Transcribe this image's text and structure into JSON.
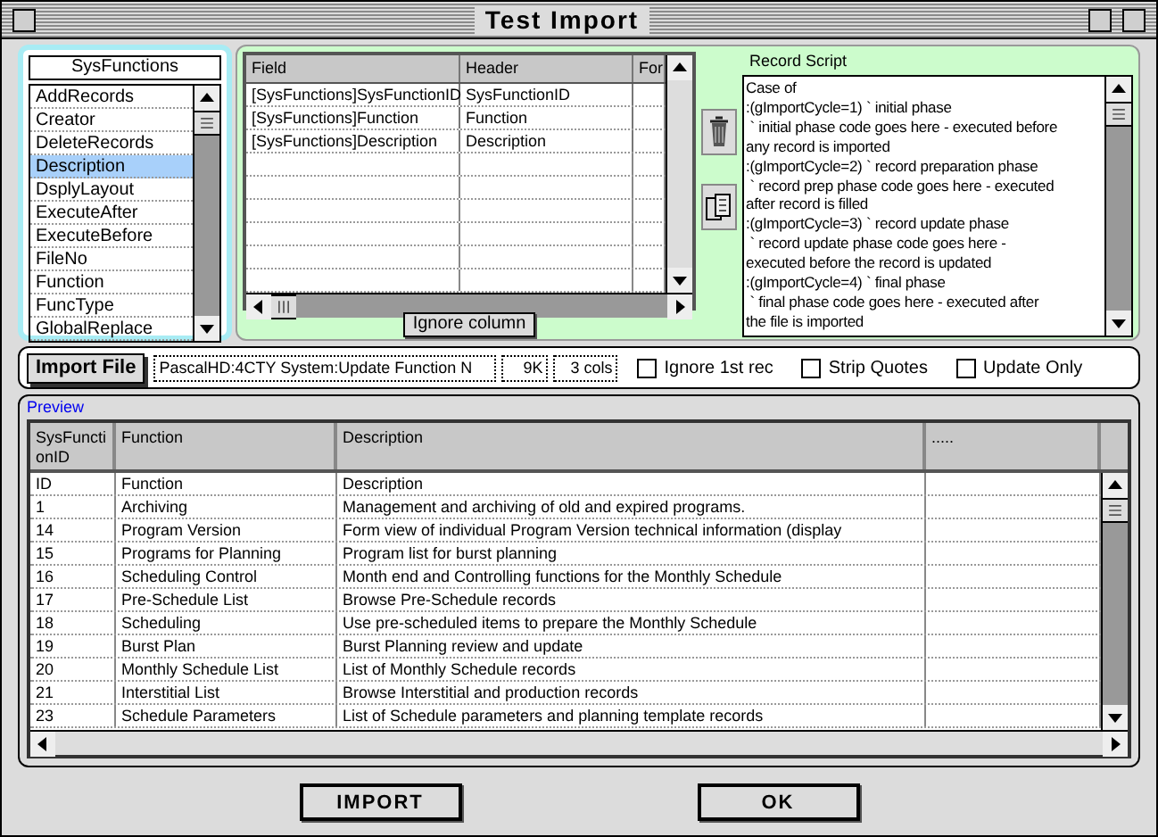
{
  "window": {
    "title": "Test Import"
  },
  "tables_list": {
    "title": "SysFunctions",
    "items": [
      {
        "label": "AddRecords",
        "selected": false
      },
      {
        "label": "Creator",
        "selected": false
      },
      {
        "label": "DeleteRecords",
        "selected": false
      },
      {
        "label": "Description",
        "selected": true
      },
      {
        "label": "DsplyLayout",
        "selected": false
      },
      {
        "label": "ExecuteAfter",
        "selected": false
      },
      {
        "label": "ExecuteBefore",
        "selected": false
      },
      {
        "label": "FileNo",
        "selected": false
      },
      {
        "label": "Function",
        "selected": false
      },
      {
        "label": "FuncType",
        "selected": false
      },
      {
        "label": "GlobalReplace",
        "selected": false
      }
    ]
  },
  "field_grid": {
    "columns": [
      "Field",
      "Header",
      "For"
    ],
    "rows": [
      {
        "field": "[SysFunctions]SysFunctionID",
        "header": "SysFunctionID"
      },
      {
        "field": "[SysFunctions]Function",
        "header": "Function"
      },
      {
        "field": "[SysFunctions]Description",
        "header": "Description"
      }
    ]
  },
  "ignore_column_button": "Ignore column",
  "record_script": {
    "label": "Record Script",
    "lines": [
      "Case of",
      ":(gImportCycle=1) ` initial phase",
      " ` initial phase code goes here - executed before",
      "any record is imported",
      ":(gImportCycle=2) ` record preparation phase",
      " ` record prep phase code goes here - executed",
      "after record is filled",
      ":(gImportCycle=3) ` record update phase",
      " ` record update phase code goes here -",
      "executed before the record is updated",
      ":(gImportCycle=4) ` final phase",
      " ` final phase code goes here - executed after",
      "the file is imported"
    ]
  },
  "import_file": {
    "button": "Import File",
    "path": "PascalHD:4CTY System:Update Function N",
    "size": "9K",
    "cols": "3 cols"
  },
  "options": [
    {
      "label": "Ignore 1st rec",
      "checked": false
    },
    {
      "label": "Strip Quotes",
      "checked": false
    },
    {
      "label": "Update Only",
      "checked": false
    }
  ],
  "preview": {
    "label": "Preview",
    "columns": [
      "SysFunctionID",
      "Function",
      "Description",
      "....."
    ],
    "rows": [
      [
        "ID",
        "Function",
        "Description"
      ],
      [
        "1",
        "Archiving",
        "Management and archiving of old and expired programs."
      ],
      [
        "14",
        "Program Version",
        "Form view of individual Program Version technical information (display"
      ],
      [
        "15",
        "Programs for Planning",
        "Program list for burst planning"
      ],
      [
        "16",
        "Scheduling Control",
        "Month end and Controlling functions for the Monthly Schedule"
      ],
      [
        "17",
        "Pre-Schedule List",
        "Browse Pre-Schedule records"
      ],
      [
        "18",
        "Scheduling",
        "Use pre-scheduled items to prepare the Monthly Schedule"
      ],
      [
        "19",
        "Burst Plan",
        "Burst Planning review and update"
      ],
      [
        "20",
        "Monthly Schedule List",
        "List of Monthly Schedule records"
      ],
      [
        "21",
        "Interstitial List",
        "Browse Interstitial and production records"
      ],
      [
        "23",
        "Schedule Parameters",
        "List of Schedule parameters and planning template records"
      ]
    ]
  },
  "buttons": [
    "IMPORT",
    "OK"
  ]
}
